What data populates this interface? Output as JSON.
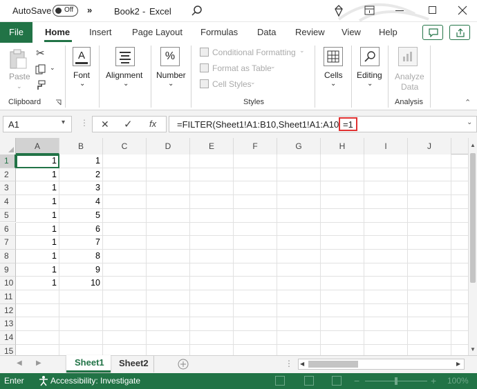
{
  "title_bar": {
    "autosave_label": "AutoSave",
    "autosave_state": "Off",
    "more_label": "»",
    "doc_title": "Book2",
    "app_sep": "-",
    "app_name": "Excel"
  },
  "tabs": [
    "File",
    "Home",
    "Insert",
    "Page Layout",
    "Formulas",
    "Data",
    "Review",
    "View",
    "Help"
  ],
  "ribbon": {
    "clipboard": {
      "paste": "Paste",
      "label": "Clipboard"
    },
    "font": {
      "label": "Font"
    },
    "alignment": {
      "label": "Alignment"
    },
    "number": {
      "label": "Number"
    },
    "styles": {
      "conditional": "Conditional Formatting",
      "table": "Format as Table",
      "cell_styles": "Cell Styles",
      "label": "Styles"
    },
    "cells": {
      "label": "Cells"
    },
    "editing": {
      "label": "Editing"
    },
    "analysis": {
      "analyze_line1": "Analyze",
      "analyze_line2": "Data",
      "label": "Analysis"
    }
  },
  "formula_bar": {
    "name_box": "A1",
    "cancel": "✕",
    "enter": "✓",
    "fx": "fx",
    "formula_main": "=FILTER(Sheet1!A1:B10,Sheet1!A1:A10",
    "formula_highlight": "=1"
  },
  "grid": {
    "columns": [
      "A",
      "B",
      "C",
      "D",
      "E",
      "F",
      "G",
      "H",
      "I",
      "J"
    ],
    "rows": [
      "1",
      "2",
      "3",
      "4",
      "5",
      "6",
      "7",
      "8",
      "9",
      "10",
      "11",
      "12",
      "13",
      "14",
      "15"
    ],
    "col_a": [
      "1",
      "1",
      "1",
      "1",
      "1",
      "1",
      "1",
      "1",
      "1",
      "1"
    ],
    "col_b": [
      "1",
      "2",
      "3",
      "4",
      "5",
      "6",
      "7",
      "8",
      "9",
      "10"
    ]
  },
  "sheets": [
    "Sheet1",
    "Sheet2"
  ],
  "status": {
    "mode": "Enter",
    "accessibility": "Accessibility: Investigate",
    "zoom": "100%"
  },
  "colors": {
    "accent": "#217346",
    "highlight_box": "#e03030"
  }
}
